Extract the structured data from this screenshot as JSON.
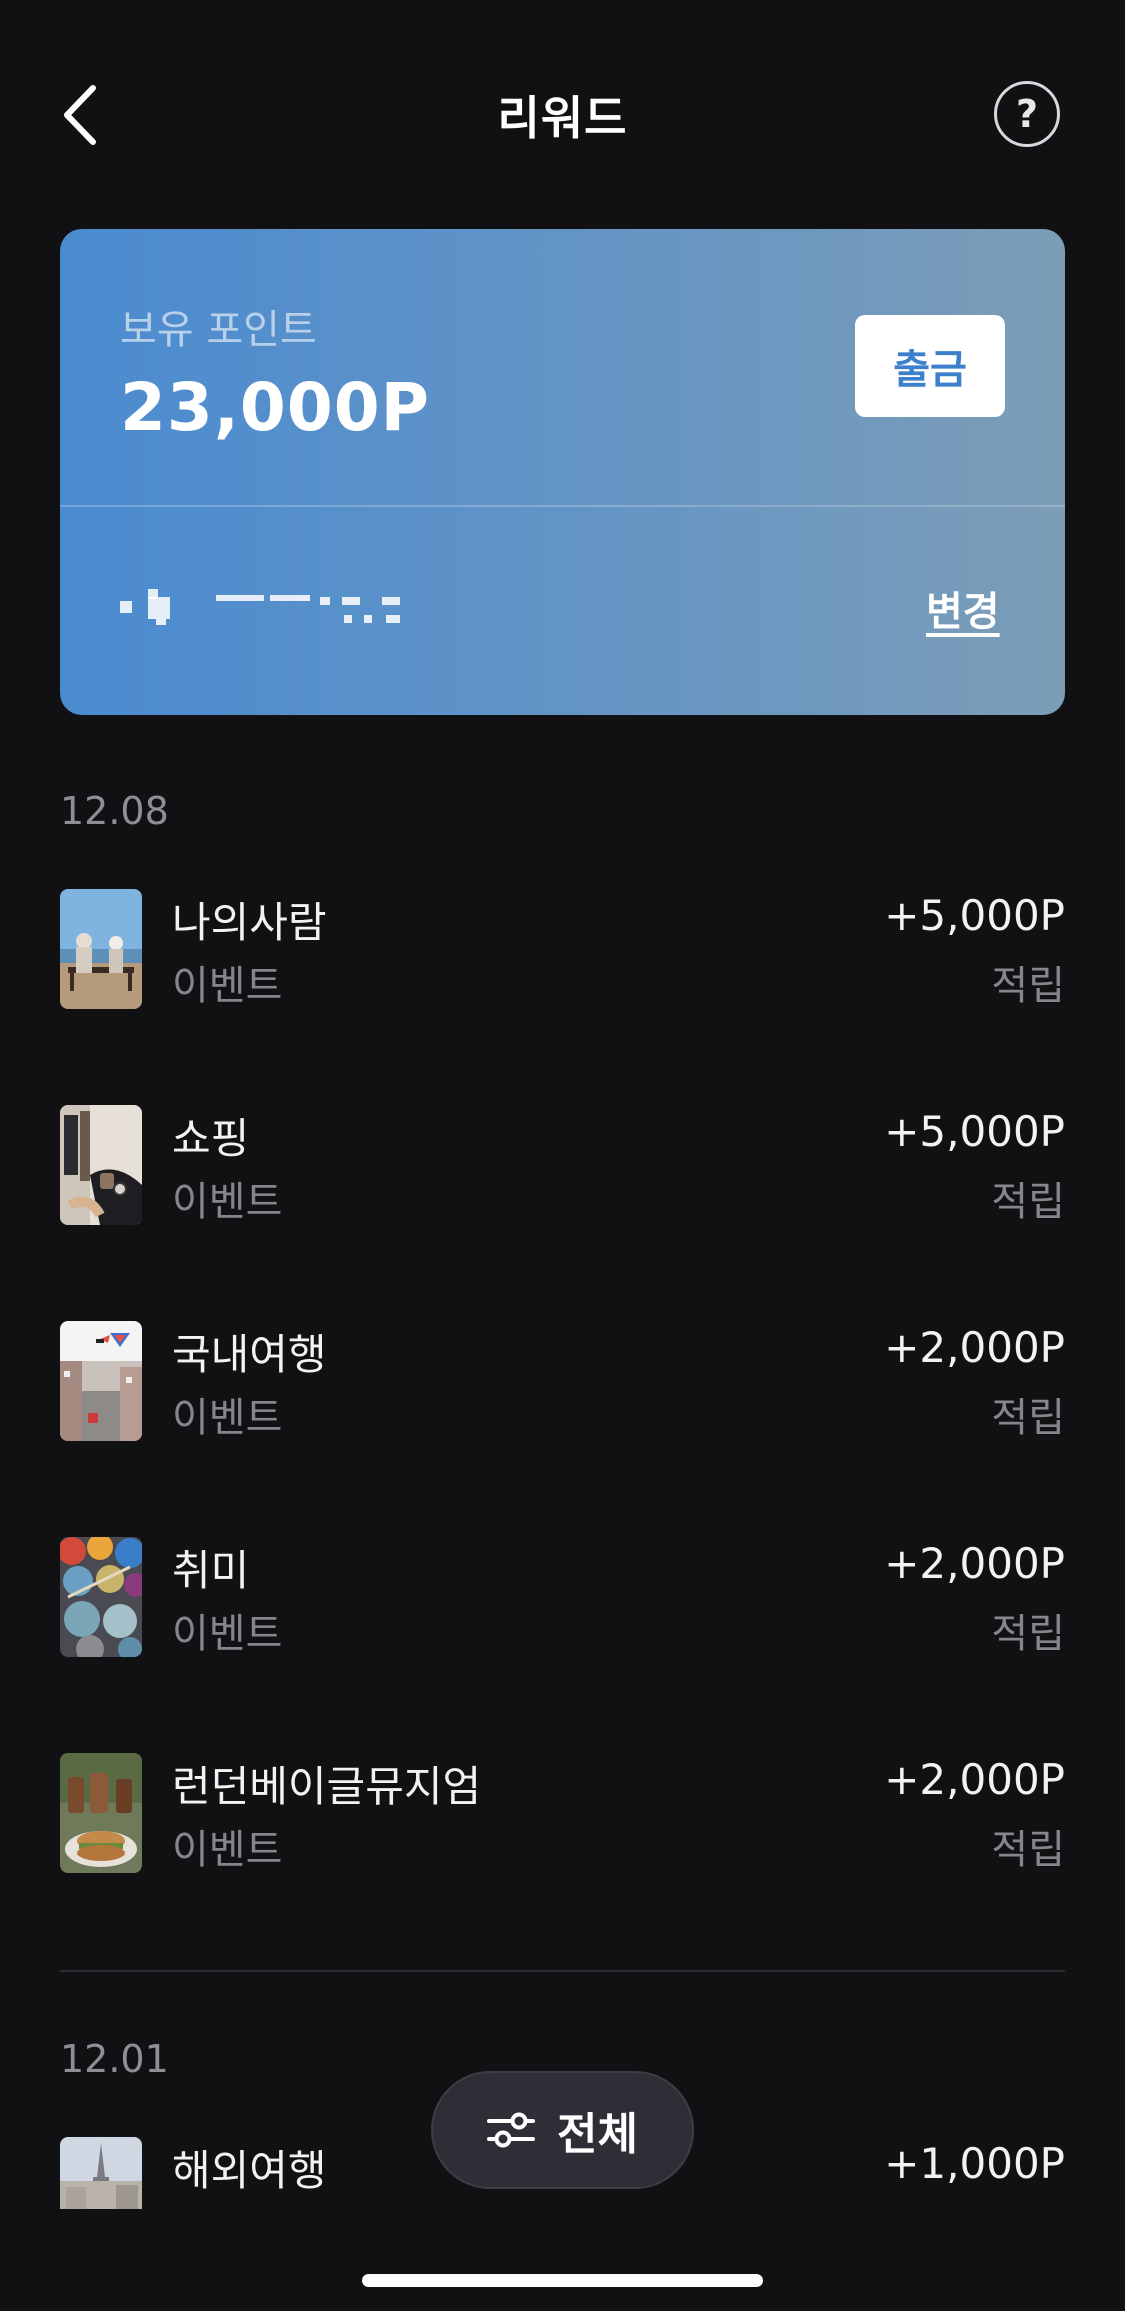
{
  "header": {
    "title": "리워드",
    "help_label": "?"
  },
  "points_card": {
    "label": "보유 포인트",
    "value": "23,000P",
    "withdraw_label": "출금",
    "change_label": "변경"
  },
  "sections": [
    {
      "date": "12.08",
      "items": [
        {
          "title": "나의사람",
          "subtitle": "이벤트",
          "amount": "+5,000P",
          "status": "적립"
        },
        {
          "title": "쇼핑",
          "subtitle": "이벤트",
          "amount": "+5,000P",
          "status": "적립"
        },
        {
          "title": "국내여행",
          "subtitle": "이벤트",
          "amount": "+2,000P",
          "status": "적립"
        },
        {
          "title": "취미",
          "subtitle": "이벤트",
          "amount": "+2,000P",
          "status": "적립"
        },
        {
          "title": "런던베이글뮤지엄",
          "subtitle": "이벤트",
          "amount": "+2,000P",
          "status": "적립"
        }
      ]
    },
    {
      "date": "12.01",
      "items": [
        {
          "title": "해외여행",
          "subtitle": "",
          "amount": "+1,000P",
          "status": ""
        }
      ]
    }
  ],
  "filter": {
    "label": "전체"
  },
  "colors": {
    "background": "#111114",
    "card_gradient_start": "#4a8bd0",
    "card_gradient_end": "#7c9db6",
    "withdraw_text": "#3c7fcb"
  }
}
